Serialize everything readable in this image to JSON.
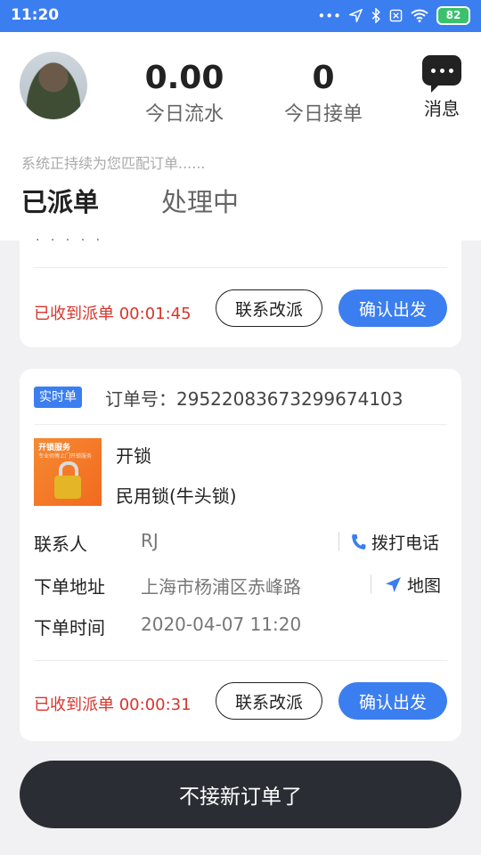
{
  "status_bar": {
    "time": "11:20",
    "battery": "82",
    "icons": [
      "dots-icon",
      "location-arrow-icon",
      "bluetooth-icon",
      "sim-off-icon",
      "wifi-icon",
      "battery-icon"
    ]
  },
  "header": {
    "stats": [
      {
        "value": "0.00",
        "label": "今日流水"
      },
      {
        "value": "0",
        "label": "今日接单"
      }
    ],
    "message_label": "消息",
    "matching_text": "系统正持续为您匹配订单......",
    "tabs": [
      {
        "label": "已派单",
        "active": true
      },
      {
        "label": "处理中",
        "active": false
      }
    ]
  },
  "orders": [
    {
      "partial_text": "· · · · ·",
      "timer": "已收到派单 00:01:45",
      "contact_reassign": "联系改派",
      "confirm_depart": "确认出发"
    },
    {
      "badge": "实时单",
      "order_number": "订单号：29522083673299674103",
      "thumb_title": "开锁服务",
      "thumb_subtitle": "专业师傅上门开锁服务",
      "service_name": "开锁",
      "service_detail": "民用锁(牛头锁)",
      "contact_label": "联系人",
      "contact_value": "RJ",
      "call_action": "拨打电话",
      "address_label": "下单地址",
      "address_value": "上海市杨浦区赤峰路",
      "map_action": "地图",
      "time_label": "下单时间",
      "time_value": "2020-04-07 11:20",
      "timer": "已收到派单 00:00:31",
      "contact_reassign": "联系改派",
      "confirm_depart": "确认出发"
    }
  ],
  "bottom_button": "不接新订单了",
  "colors": {
    "accent": "#3b7ef0",
    "timer_red": "#d9342b",
    "dark_button": "#2a2d33"
  }
}
